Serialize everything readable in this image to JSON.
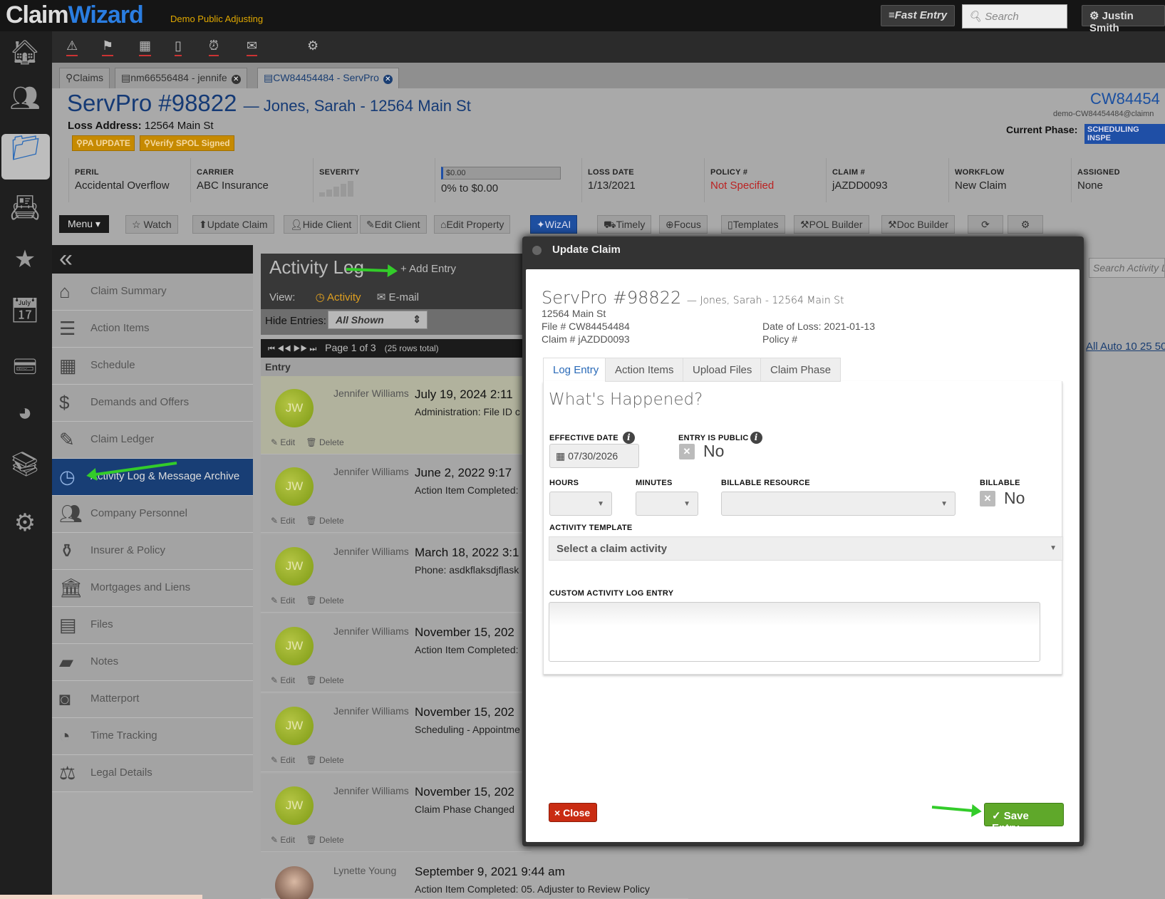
{
  "app": {
    "logo_a": "Claim",
    "logo_b": "Wizard",
    "org": "Demo Public Adjusting"
  },
  "topbar": {
    "fast_entry": "Fast Entry",
    "search_placeholder": "Search",
    "user": "Justin Smith"
  },
  "file_tabs": [
    {
      "label": "Claims"
    },
    {
      "label": "nm66556484 - jennife"
    },
    {
      "label": "CW84454484 - ServPro"
    }
  ],
  "header": {
    "title": "ServPro #98822",
    "subtitle": "— Jones, Sarah - 12564 Main St",
    "loss_address_label": "Loss Address:",
    "loss_address": "12564 Main St",
    "badges": [
      "PA UPDATE",
      "Verify SPOL Signed"
    ],
    "claim_no": "CW84454",
    "claim_email": "demo-CW84454484@claimn",
    "phase_label": "Current Phase:",
    "phase": "SCHEDULING INSPE"
  },
  "meta": [
    {
      "k": "PERIL",
      "v": "Accidental Overflow"
    },
    {
      "k": "CARRIER",
      "v": "ABC Insurance"
    },
    {
      "k": "SEVERITY",
      "v": ""
    },
    {
      "k": "",
      "v": "0% to $0.00",
      "bar": "$0.00"
    },
    {
      "k": "LOSS DATE",
      "v": "1/13/2021"
    },
    {
      "k": "POLICY #",
      "v": "Not Specified"
    },
    {
      "k": "CLAIM #",
      "v": "jAZDD0093"
    },
    {
      "k": "WORKFLOW",
      "v": "New Claim"
    },
    {
      "k": "ASSIGNED",
      "v": "None"
    }
  ],
  "actions": {
    "menu": "Menu",
    "watch": "Watch",
    "update_claim": "Update Claim",
    "hide_client": "Hide Client",
    "edit_client": "Edit Client",
    "edit_property": "Edit Property",
    "wizai": "WizAI",
    "timely": "Timely",
    "focus": "Focus",
    "templates": "Templates",
    "pol_builder": "POL Builder",
    "doc_builder": "Doc Builder"
  },
  "sidebar": [
    {
      "label": "Claim Summary"
    },
    {
      "label": "Action Items"
    },
    {
      "label": "Schedule"
    },
    {
      "label": "Demands and Offers"
    },
    {
      "label": "Claim Ledger"
    },
    {
      "label": "Activity Log & Message Archive"
    },
    {
      "label": "Company Personnel"
    },
    {
      "label": "Insurer & Policy"
    },
    {
      "label": "Mortgages and Liens"
    },
    {
      "label": "Files"
    },
    {
      "label": "Notes"
    },
    {
      "label": "Matterport"
    },
    {
      "label": "Time Tracking"
    },
    {
      "label": "Legal Details"
    }
  ],
  "activity": {
    "title": "Activity Log",
    "add_entry": "Add Entry",
    "view_label": "View:",
    "view_activity": "Activity",
    "view_email": "E-mail",
    "hide_label": "Hide Entries:",
    "hide_value": "All Shown",
    "page": "Page 1 of 3",
    "rows_total": "(25 rows total)",
    "entry_header": "Entry",
    "search_placeholder": "Search Activity L",
    "page_sizes": "All Auto 10 25 50",
    "edit": "Edit",
    "delete": "Delete",
    "rows": [
      {
        "initials": "JW",
        "name": "Jennifer Williams",
        "date": "July 19, 2024 2:11",
        "desc": "Administration: File ID c"
      },
      {
        "initials": "JW",
        "name": "Jennifer Williams",
        "date": "June 2, 2022 9:17",
        "desc": "Action Item Completed:"
      },
      {
        "initials": "JW",
        "name": "Jennifer Williams",
        "date": "March 18, 2022 3:1",
        "desc": "Phone: asdkflaksdjflask"
      },
      {
        "initials": "JW",
        "name": "Jennifer Williams",
        "date": "November 15, 202",
        "desc": "Action Item Completed:"
      },
      {
        "initials": "JW",
        "name": "Jennifer Williams",
        "date": "November 15, 202",
        "desc": "Scheduling - Appointme"
      },
      {
        "initials": "JW",
        "name": "Jennifer Williams",
        "date": "November 15, 202",
        "desc": "Claim Phase Changed"
      }
    ],
    "last_row": {
      "name": "Lynette Young",
      "date": "September 9, 2021 9:44 am",
      "desc": "Action Item Completed: 05. Adjuster to Review Policy"
    }
  },
  "modal": {
    "title": "Update Claim",
    "claim_title": "ServPro #98822",
    "claim_sub": "— Jones, Sarah - 12564 Main St",
    "address": "12564 Main St",
    "file": "File # CW84454484",
    "claim": "Claim # jAZDD0093",
    "date_of_loss": "Date of Loss: 2021-01-13",
    "policy": "Policy #",
    "tabs": [
      "Log Entry",
      "Action Items",
      "Upload Files",
      "Claim Phase"
    ],
    "section": "What's Happened?",
    "effective_date_label": "EFFECTIVE DATE",
    "effective_date": "07/30/2026",
    "entry_public_label": "ENTRY IS PUBLIC",
    "entry_public": "No",
    "hours_label": "HOURS",
    "minutes_label": "MINUTES",
    "billable_resource_label": "BILLABLE RESOURCE",
    "billable_label": "BILLABLE",
    "billable": "No",
    "template_label": "ACTIVITY TEMPLATE",
    "template_placeholder": "Select a claim activity",
    "custom_label": "CUSTOM ACTIVITY LOG ENTRY",
    "close": "Close",
    "save": "Save Entry"
  },
  "colors": {
    "accent": "#1a3e72",
    "save": "#5fa82a",
    "close": "#c92c12",
    "annotation_arrow": "#33cc2a"
  }
}
